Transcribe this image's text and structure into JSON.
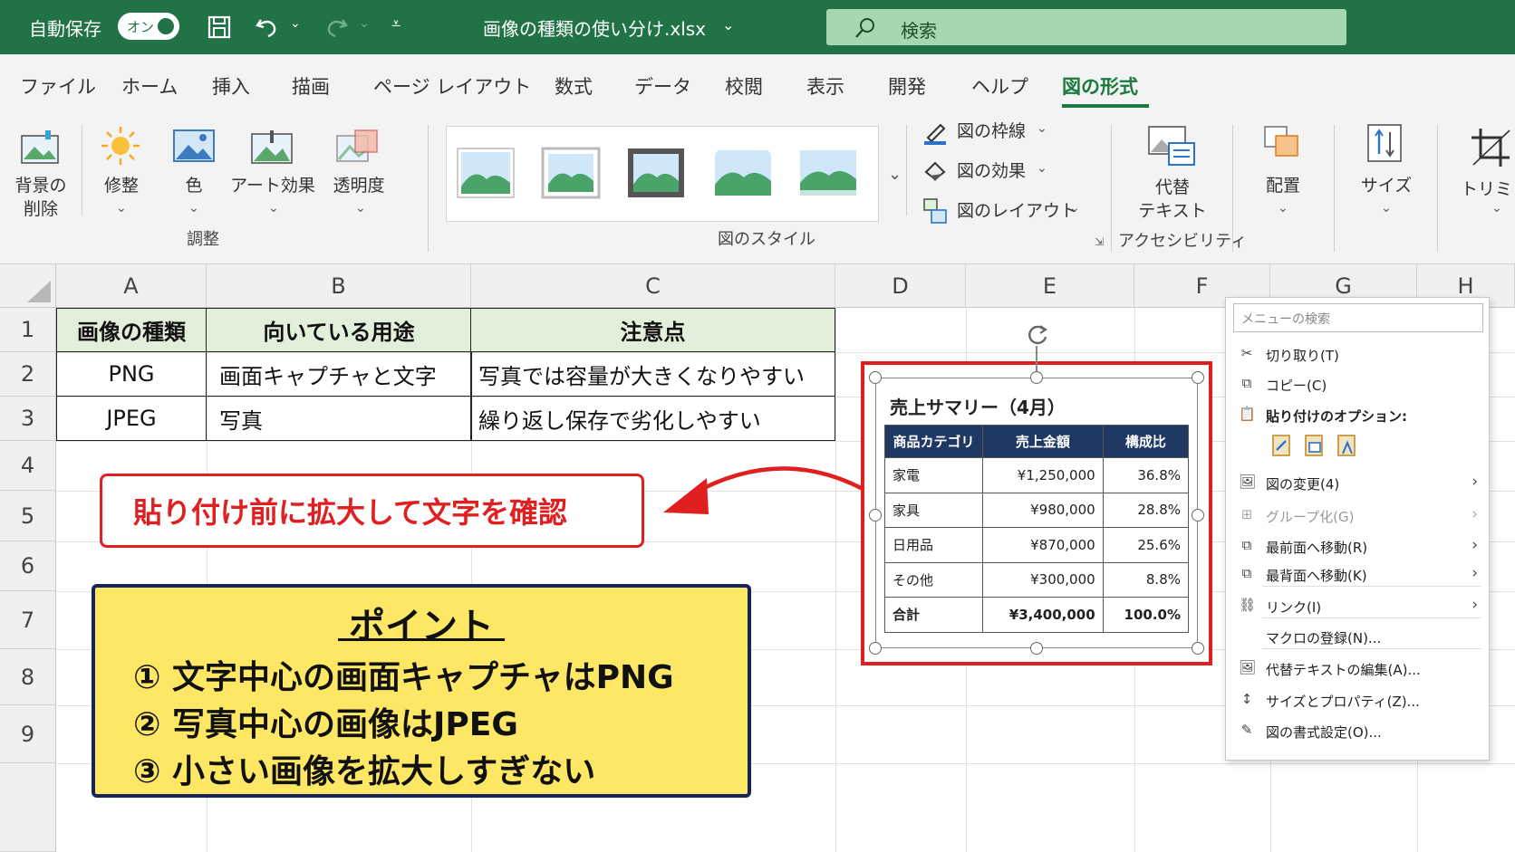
{
  "titlebar": {
    "autosave_label": "自動保存",
    "autosave_state": "オン",
    "filename": "画像の種類の使い分け.xlsx",
    "search_placeholder": "検索"
  },
  "tabs": [
    "ファイル",
    "ホーム",
    "挿入",
    "描画",
    "ページ レイアウト",
    "数式",
    "データ",
    "校閲",
    "表示",
    "開発",
    "ヘルプ",
    "図の形式"
  ],
  "ribbon": {
    "adjust": {
      "remove_bg": [
        "背景の",
        "削除"
      ],
      "corrections": "修整",
      "color": "色",
      "artistic": "アート効果",
      "transparency": "透明度",
      "group": "調整"
    },
    "styles_group": "図のスタイル",
    "picture_border": "図の枠線",
    "picture_effects": "図の効果",
    "picture_layout": "図のレイアウト",
    "alt_text": [
      "代替",
      "テキスト"
    ],
    "accessibility_group": "アクセシビリティ",
    "arrange": "配置",
    "size": "サイズ",
    "crop": "トリミング"
  },
  "columns": [
    "A",
    "B",
    "C",
    "D",
    "E",
    "F",
    "G",
    "H"
  ],
  "rows": [
    "1",
    "2",
    "3",
    "4",
    "5",
    "6",
    "7",
    "8",
    "9"
  ],
  "table": {
    "headers": [
      "画像の種類",
      "向いている用途",
      "注意点"
    ],
    "rows": [
      [
        "PNG",
        "画面キャプチャと文字",
        "写真では容量が大きくなりやすい"
      ],
      [
        "JPEG",
        "写真",
        "繰り返し保存で劣化しやすい"
      ]
    ]
  },
  "callout": "貼り付け前に拡大して文字を確認",
  "point": {
    "title": "ポイント",
    "items": [
      "① 文字中心の画面キャプチャはPNG",
      "② 写真中心の画像はJPEG",
      "③ 小さい画像を拡大しすぎない"
    ]
  },
  "summary": {
    "title": "売上サマリー（4月）",
    "headers": [
      "商品カテゴリ",
      "売上金額",
      "構成比"
    ],
    "rows": [
      [
        "家電",
        "¥1,250,000",
        "36.8%"
      ],
      [
        "家具",
        "¥980,000",
        "28.8%"
      ],
      [
        "日用品",
        "¥870,000",
        "25.6%"
      ],
      [
        "その他",
        "¥300,000",
        "8.8%"
      ],
      [
        "合計",
        "¥3,400,000",
        "100.0%"
      ]
    ]
  },
  "context_menu": {
    "search": "メニューの検索",
    "cut": "切り取り(T)",
    "copy": "コピー(C)",
    "paste_options": "貼り付けのオプション:",
    "change_picture": "図の変更(4)",
    "group": "グループ化(G)",
    "bring_front": "最前面へ移動(R)",
    "send_back": "最背面へ移動(K)",
    "link": "リンク(I)",
    "assign_macro": "マクロの登録(N)...",
    "edit_alt": "代替テキストの編集(A)...",
    "size_props": "サイズとプロパティ(Z)...",
    "format_picture": "図の書式設定(O)..."
  }
}
